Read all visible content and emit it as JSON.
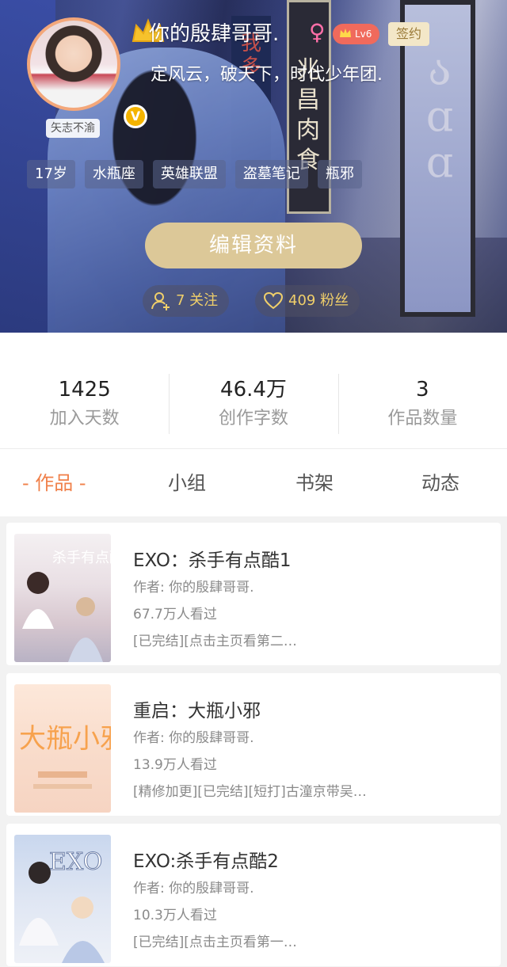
{
  "profile": {
    "name": "你的殷肆哥哥.",
    "gender_symbol": "♀",
    "level": "Lv6",
    "signed": "签约",
    "bio": "定风云，破天下，时代少年团.",
    "motto": "矢志不渝",
    "tags": [
      "17岁",
      "水瓶座",
      "英雄联盟",
      "盗墓笔记",
      "瓶邪"
    ],
    "edit_button": "编辑资料",
    "follow_label": "7 关注",
    "fans_label": "409 粉丝",
    "hero_sign_text": "兆昌肉食",
    "hero_red_sign_text": "我多"
  },
  "stats": [
    {
      "value": "1425",
      "label": "加入天数"
    },
    {
      "value": "46.4万",
      "label": "创作字数"
    },
    {
      "value": "3",
      "label": "作品数量"
    }
  ],
  "tabs": [
    "- 作品 -",
    "小组",
    "书架",
    "动态"
  ],
  "works": [
    {
      "title": "EXO：杀手有点酷1",
      "author": "作者: 你的殷肆哥哥.",
      "views": "67.7万人看过",
      "desc": "[已完结][点击主页看第二…",
      "cover_text": "杀手有点酷"
    },
    {
      "title": "重启：大瓶小邪",
      "author": "作者: 你的殷肆哥哥.",
      "views": "13.9万人看过",
      "desc": "[精修加更][已完结][短打]古潼京带吴…",
      "cover_text": "大瓶小邪"
    },
    {
      "title": "EXO:杀手有点酷2",
      "author": "作者: 你的殷肆哥哥.",
      "views": "10.3万人看过",
      "desc": "[已完结][点击主页看第一…",
      "cover_text": "EXO"
    }
  ],
  "colors": {
    "accent": "#f0804a",
    "gold": "#dcc898",
    "follow_text": "#f0cf6a",
    "level_bg": "#f06a5c"
  }
}
